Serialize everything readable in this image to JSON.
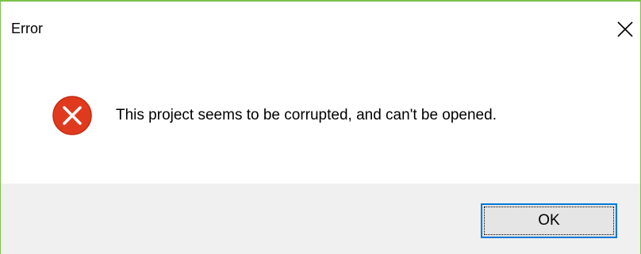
{
  "window": {
    "title": "Error",
    "accent_color": "#7cc24a"
  },
  "titlebar": {
    "close_icon": "close-icon"
  },
  "content": {
    "icon": "error-icon",
    "icon_color": "#e81123",
    "message": "This project seems to be corrupted, and can't be opened."
  },
  "footer": {
    "ok_label": "OK",
    "focus_color": "#0078d7"
  }
}
